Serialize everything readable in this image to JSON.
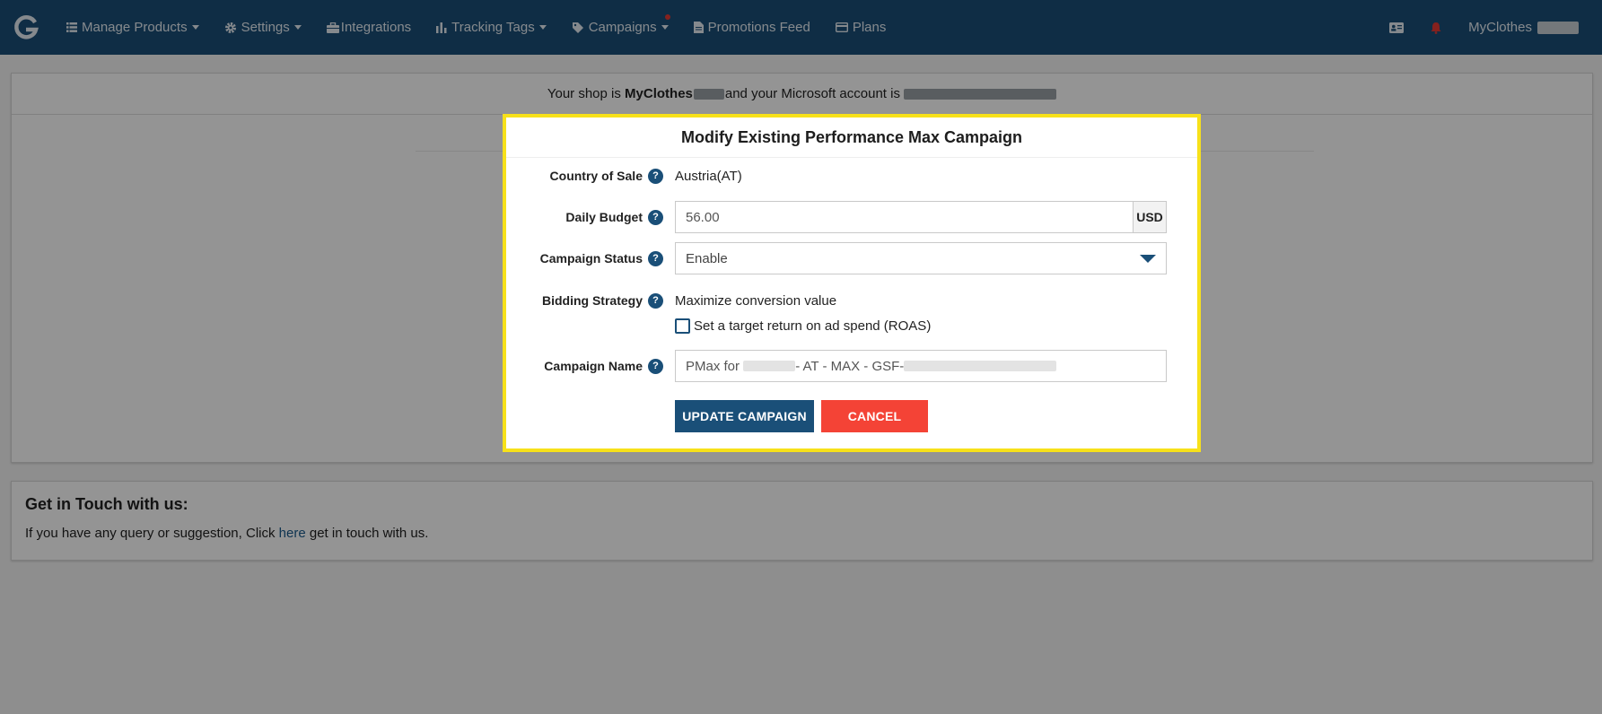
{
  "navbar": {
    "items": [
      {
        "label": "Manage Products",
        "icon": "list-icon",
        "dropdown": true
      },
      {
        "label": "Settings",
        "icon": "gear-icon",
        "dropdown": true
      },
      {
        "label": "Integrations",
        "icon": "briefcase-icon",
        "dropdown": false
      },
      {
        "label": "Tracking Tags",
        "icon": "bar-chart-icon",
        "dropdown": true
      },
      {
        "label": "Campaigns",
        "icon": "tag-icon",
        "dropdown": true
      },
      {
        "label": "Promotions Feed",
        "icon": "document-icon",
        "dropdown": false
      },
      {
        "label": "Plans",
        "icon": "credit-card-icon",
        "dropdown": false
      }
    ],
    "user_name": "MyClothes"
  },
  "shop_bar": {
    "prefix": "Your shop is ",
    "shop_name": "MyClothes",
    "middle": "and your Microsoft account is "
  },
  "contact": {
    "title": "Get in Touch with us:",
    "text_before": "If you have any query or suggestion, Click ",
    "link_text": "here",
    "text_after": " get in touch with us."
  },
  "modal": {
    "title": "Modify Existing Performance Max Campaign",
    "country_label": "Country of Sale",
    "country_value": "Austria(AT)",
    "budget_label": "Daily Budget",
    "budget_value": "56.00",
    "budget_currency": "USD",
    "status_label": "Campaign Status",
    "status_value": "Enable",
    "bidding_label": "Bidding Strategy",
    "bidding_value": "Maximize conversion value",
    "roas_checkbox_label": "Set a target return on ad spend (ROAS)",
    "roas_checked": false,
    "name_label": "Campaign Name",
    "name_prefix": "PMax for ",
    "name_middle": "- AT - MAX - GSF-",
    "update_button": "UPDATE CAMPAIGN",
    "cancel_button": "CANCEL"
  },
  "colors": {
    "navbar": "#1a4f78",
    "primary": "#1a4f78",
    "danger": "#f44336",
    "highlight_border": "#f7e11a",
    "notification": "#e53935"
  }
}
